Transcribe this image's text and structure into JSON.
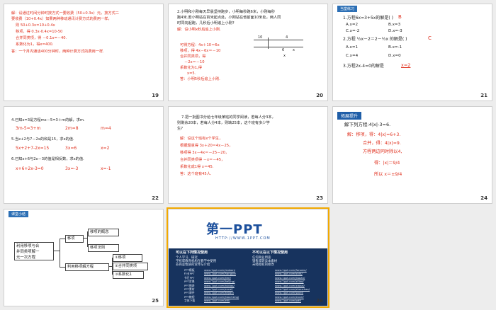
{
  "slides": [
    {
      "number": "19",
      "lines": [
        "解：设通过时间分钟时按方式一要收费（50+0.3x）元，按方式二",
        "要收费（10+0.4x）如果两种移动通讯计费方式的费用一样，",
        "则 50+0.3x=10+0.4x",
        "移项，得 0.3x-0.4x=10-50",
        "合并同类项，得 －0.1x=－40.",
        "系数化为1，得x=400.",
        "答：一个月内通话400分钟时，两种计费方式的费用一样."
      ]
    },
    {
      "number": "20",
      "problem": [
        "2.小明和小刚每天早晨坚持跑步，小明每秒跑6米，小刚每秒",
        "跑4米.若小明站在百米起点处，小刚站在他前面10米处，两人同",
        "时同向起跑，几秒后小明追上小刚?"
      ],
      "answer_head": "解：设小明x秒后追上小刚.",
      "diagram": {
        "left": "10",
        "mid": "4",
        "bottom_mid": "6",
        "bottom_var": "x",
        "below": "x"
      },
      "steps": [
        "可得方程：4x＋10＝6x",
        "移项，得 4x－6x＝－10",
        "合并同类项，得",
        "－2x＝－10",
        "系数化为1,得",
        "x=5.",
        "答：小明5秒后追上小刚."
      ]
    },
    {
      "number": "21",
      "tag": "当堂练习",
      "q1": "1.方程6x=3+5x的解是(    )",
      "q1_answer": "B",
      "q1_opts": [
        "A.x=2",
        "B.x=3",
        "C.x=-2",
        "D.x=-3"
      ],
      "q2": "2.方程 ½x－2＝2－½x 的解是(    )",
      "q2_answer": "C",
      "q2_opts": [
        "A.x=1",
        "B.x=-1",
        "C.x=4",
        "D.x=0"
      ],
      "q3": "3.方程2x-4=0的解是",
      "q3_answer": "x=2"
    },
    {
      "number": "22",
      "p1": "4.已知x=3是方程mx－5=3＋m的解，求m.",
      "p1_steps": [
        "3m-5=3+m",
        "2m=8",
        "m=4"
      ],
      "p2": "5.当x+2与7－2x的和是15，求x的值.",
      "p2_steps": [
        "5x+2+7-2x=15",
        "3x=6",
        "x=2"
      ],
      "p3": "6.已知x+6与2x－3的值是相反数，求x的值.",
      "p3_steps": [
        "x+6+2x-3=0",
        "3x=-3",
        "x=-1"
      ]
    },
    {
      "number": "23",
      "problem": [
        "7.把一批图书分给七年级某班的同学阅读，若每人分3本，",
        "则剩余20本，若每人分4本，则缺25本，这个班有多少学",
        "生?"
      ],
      "steps": [
        "解：设这个班有x个学生，",
        "根据题意得  3x＋20＝4x－25，",
        "移项得      3x－4x＝－25－20，",
        "合并同类项得   －x＝－45，",
        "系数化成1得 x＝45.",
        "答：这个班有45人."
      ]
    },
    {
      "number": "24",
      "tag": "拓展提升",
      "title": "解下列方程:4|x|-3=6.",
      "steps": [
        "解：移项，得：4|x|=6+3.",
        "合并，得：4|x|=9.",
        "方程两边同时除以4,",
        "得：|x|＝9/4",
        "所以 x＝±9/4"
      ]
    },
    {
      "number": "25",
      "tag": "课堂小结",
      "root": [
        "利用移项与合",
        "并同类项解一",
        "元一次方程"
      ],
      "branch1": "移项",
      "leaf1": "移项的概念",
      "leaf2": "移项法则",
      "branch2": "利用移项解方程",
      "steps": [
        "①移项",
        "②合并同类项",
        "③系数化1"
      ]
    },
    {
      "number": "26",
      "logo": "第一PPT",
      "url": "HTTP://WWW.1PPT.COM",
      "col1_title": "可以在下列情况使用",
      "col1": [
        "个人学习、研究",
        "学校或教育机构在教学中使用",
        "非商业性质的宣传与介绍"
      ],
      "col2_title": "不可以在以下情况使用",
      "col2": [
        "任何商业用途",
        "销售或转卖本素材",
        "未经授权的修改"
      ],
      "links_left": [
        "PPT模板",
        "行业PPT",
        "节日PPT",
        "PPT背景",
        "PPT图表",
        "PPT素材",
        "PPT课件",
        "PPT教程",
        "字体下载"
      ],
      "links_mid": [
        "www.1ppt.com/moban/",
        "www.1ppt.com/hangye/",
        "www.1ppt.com/jieri/",
        "www.1ppt.com/beijing/",
        "www.1ppt.com/tubiao/",
        "www.1ppt.com/sucai/",
        "www.1ppt.com/kejian/",
        "www.1ppt.com/jiaocheng/",
        "www.1ppt.com/ziti/"
      ],
      "links_right": [
        "www.1ppt.com/fanwen/",
        "www.1ppt.com/shiti/",
        "www.1ppt.com/jiaoan/",
        "www.1ppt.com/ziliao/",
        "www.1ppt.com/xiazai/",
        "www.1ppt.com/shouchao/",
        "www.1ppt.com/word/",
        "www.1ppt.com/excel/",
        "www.1ppt.com/pdf/"
      ]
    }
  ]
}
